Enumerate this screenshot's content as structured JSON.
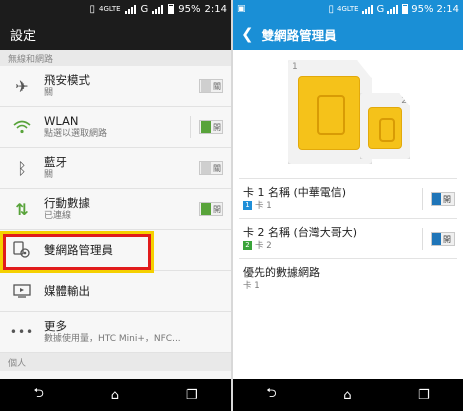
{
  "left": {
    "status": {
      "network": "4GLTE",
      "carrier2": "G",
      "battery": "95%",
      "time": "2:14"
    },
    "title": "設定",
    "section_wireless": "無線和網路",
    "items": [
      {
        "icon": "airplane-icon",
        "title": "飛安模式",
        "subtitle": "關",
        "toggle": "關",
        "on": false
      },
      {
        "icon": "wifi-icon",
        "title": "WLAN",
        "subtitle": "點選以選取網路",
        "toggle": "開",
        "on": true
      },
      {
        "icon": "bluetooth-icon",
        "title": "藍牙",
        "subtitle": "關",
        "toggle": "關",
        "on": false
      },
      {
        "icon": "mobile-data-icon",
        "title": "行動數據",
        "subtitle": "已連線",
        "toggle": "開",
        "on": true
      },
      {
        "icon": "dual-sim-gear-icon",
        "title": "雙網路管理員",
        "subtitle": ""
      },
      {
        "icon": "media-output-icon",
        "title": "媒體輸出",
        "subtitle": ""
      },
      {
        "icon": "more-icon",
        "title": "更多",
        "subtitle": "數據使用量，HTC Mini+，NFC..."
      }
    ],
    "section_personal": "個人"
  },
  "right": {
    "status": {
      "network": "4GLTE",
      "carrier2": "G",
      "battery": "95%",
      "time": "2:14"
    },
    "title": "雙網路管理員",
    "sim1_label": "1",
    "sim2_label": "2",
    "rows": [
      {
        "title": "卡 1 名稱 (中華電信)",
        "badge": "1",
        "badge_color": "#1f8fd8",
        "subtitle": "卡 1",
        "toggle": "開"
      },
      {
        "title": "卡 2 名稱 (台灣大哥大)",
        "badge": "2",
        "badge_color": "#3aa43a",
        "subtitle": "卡 2",
        "toggle": "開"
      }
    ],
    "preferred": {
      "title": "優先的數據網路",
      "subtitle": "卡 1"
    }
  },
  "nav": {
    "back": "⮌",
    "home": "⌂",
    "recents": "❐"
  },
  "colors": {
    "accent_blue": "#1a8fd6",
    "highlight_red": "#e11b1b",
    "highlight_yellow": "#f5d000",
    "toggle_on": "#58a33a"
  }
}
